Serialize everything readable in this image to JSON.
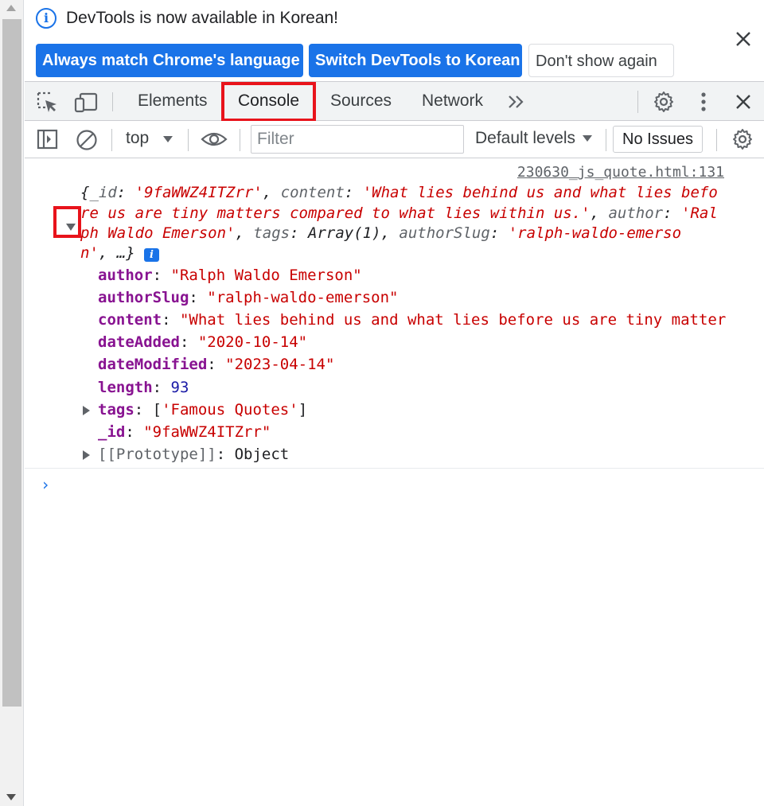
{
  "infobar": {
    "message": "DevTools is now available in Korean!",
    "buttons": {
      "always_match": "Always match Chrome's language",
      "switch": "Switch DevTools to Korean",
      "dont_show": "Don't show again"
    }
  },
  "tabs": [
    "Elements",
    "Console",
    "Sources",
    "Network"
  ],
  "active_tab": "Console",
  "console_toolbar": {
    "context": "top",
    "filter_placeholder": "Filter",
    "levels": "Default levels",
    "issues": "No Issues"
  },
  "log": {
    "source": "230630_js_quote.html:131",
    "summary": {
      "id_key": "_id",
      "id_value": "'9faWWZ4ITZrr'",
      "content_key": "content",
      "content_value": "'What lies behind us and what lies before us are tiny matters compared to what lies within us.'",
      "author_key": "author",
      "author_value": "'Ralph Waldo Emerson'",
      "tags_key": "tags",
      "tags_value": "Array(1)",
      "slug_key": "authorSlug",
      "slug_value": "'ralph-waldo-emerson'",
      "ellipsis": "…"
    },
    "properties": [
      {
        "key": "author",
        "value": "\"Ralph Waldo Emerson\"",
        "kind": "string"
      },
      {
        "key": "authorSlug",
        "value": "\"ralph-waldo-emerson\"",
        "kind": "string"
      },
      {
        "key": "content",
        "value": "\"What lies behind us and what lies before us are tiny matter",
        "kind": "string"
      },
      {
        "key": "dateAdded",
        "value": "\"2020-10-14\"",
        "kind": "string"
      },
      {
        "key": "dateModified",
        "value": "\"2023-04-14\"",
        "kind": "string"
      },
      {
        "key": "length",
        "value": "93",
        "kind": "number"
      },
      {
        "key": "tags",
        "value": "'Famous Quotes'",
        "kind": "array"
      },
      {
        "key": "_id",
        "value": "\"9faWWZ4ITZrr\"",
        "kind": "string"
      },
      {
        "key": "[[Prototype]]",
        "value": "Object",
        "kind": "object"
      }
    ]
  },
  "prompt_symbol": "›",
  "colors": {
    "accent": "#1a73e8",
    "highlight": "#e8131b",
    "string": "#c80000",
    "key": "#881391",
    "number": "#1a1aa6"
  }
}
